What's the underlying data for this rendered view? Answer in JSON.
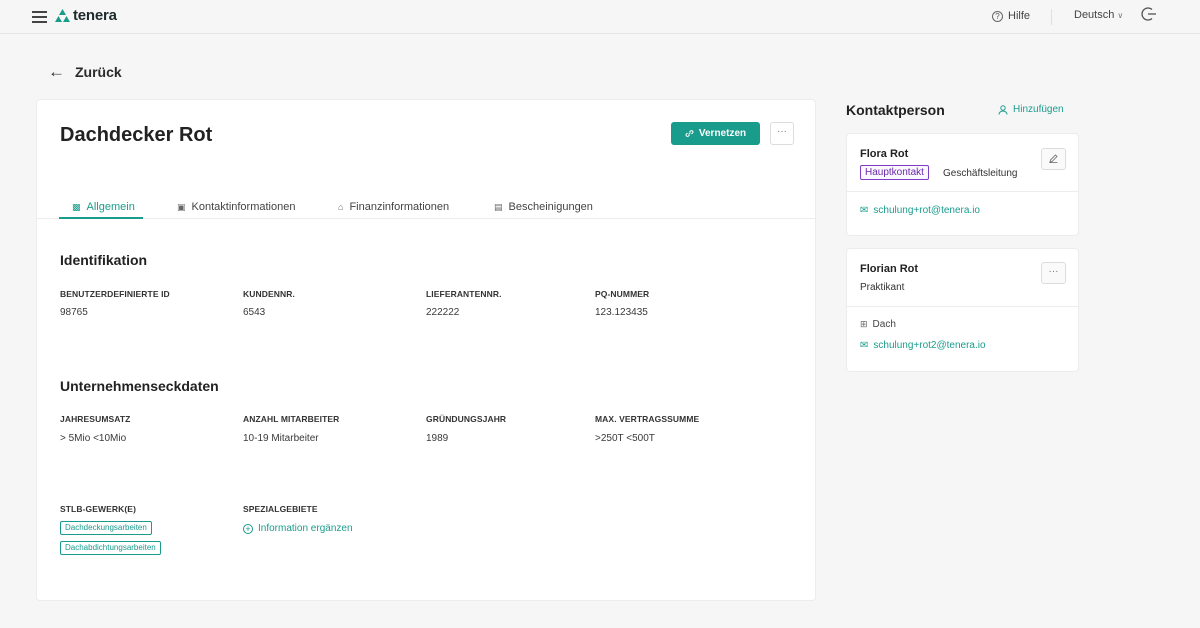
{
  "header": {
    "logo_text": "tenera",
    "help_label": "Hilfe",
    "language": "Deutsch",
    "brand_color": "#1a9c8c"
  },
  "back_label": "Zurück",
  "company": {
    "name": "Dachdecker Rot",
    "connect_label": "Vernetzen",
    "more_label": "···"
  },
  "tabs": [
    {
      "label": "Allgemein",
      "icon": "building-icon",
      "active": true
    },
    {
      "label": "Kontaktinformationen",
      "icon": "contact-card-icon",
      "active": false
    },
    {
      "label": "Finanzinformationen",
      "icon": "bank-icon",
      "active": false
    },
    {
      "label": "Bescheinigungen",
      "icon": "certificate-icon",
      "active": false
    }
  ],
  "identification": {
    "title": "Identifikation",
    "fields": [
      {
        "label": "BENUTZERDEFINIERTE ID",
        "value": "98765"
      },
      {
        "label": "KUNDENNR.",
        "value": "6543"
      },
      {
        "label": "LIEFERANTENNR.",
        "value": "222222"
      },
      {
        "label": "PQ-NUMMER",
        "value": "123.123435"
      }
    ]
  },
  "company_data": {
    "title": "Unternehmenseckdaten",
    "fields": [
      {
        "label": "JAHRESUMSATZ",
        "value": "> 5Mio <10Mio"
      },
      {
        "label": "ANZAHL MITARBEITER",
        "value": "10-19 Mitarbeiter"
      },
      {
        "label": "GRÜNDUNGSJAHR",
        "value": "1989"
      },
      {
        "label": "MAX. VERTRAGSSUMME",
        "value": ">250T <500T"
      }
    ]
  },
  "trades": {
    "label": "STLB-GEWERK(E)",
    "tags": [
      "Dachdeckungsarbeiten",
      "Dachabdichtungsarbeiten"
    ]
  },
  "specialties": {
    "label": "SPEZIALGEBIETE",
    "add_label": "Information ergänzen"
  },
  "contacts": {
    "title": "Kontaktperson",
    "add_label": "Hinzufügen",
    "people": [
      {
        "name": "Flora Rot",
        "badge": "Hauptkontakt",
        "role": "Geschäftsleitung",
        "email": "schulung+rot@tenera.io"
      },
      {
        "name": "Florian Rot",
        "role": "Praktikant",
        "trade": "Dach",
        "email": "schulung+rot2@tenera.io",
        "more_label": "···"
      }
    ]
  }
}
